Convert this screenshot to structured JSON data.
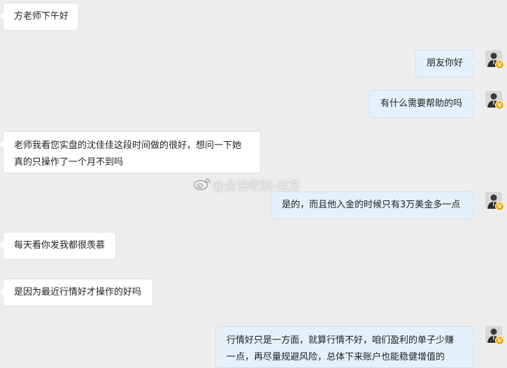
{
  "messages": [
    {
      "sender": "other",
      "text": "方老师下午好"
    },
    {
      "sender": "self",
      "text": "朋友你好"
    },
    {
      "sender": "self",
      "text": "有什么需要帮助的吗"
    },
    {
      "sender": "other",
      "line1": "老师我看您实盘的沈佳佳这段时间做的很好，想问一下她",
      "line2": "真的只操作了一个月不到吗"
    },
    {
      "sender": "self",
      "text": "是的，而且他入金的时候只有3万美金多一点"
    },
    {
      "sender": "other",
      "text": "每天看你发我都很羡慕"
    },
    {
      "sender": "other",
      "text": "是因为最近行情好才操作的好吗"
    },
    {
      "sender": "self",
      "line1": "行情好只是一方面，就算行情不好，咱们盈利的单子少赚",
      "line2": "一点，再尽量规避风险，总体下来账户也能稳健增值的"
    }
  ],
  "avatar": {
    "badge": "V",
    "badge_color": "#f2a900"
  },
  "watermark": {
    "text": "@金油收割-老方",
    "icon": "weibo-icon"
  },
  "colors": {
    "background": "#ededed",
    "incoming_bubble": "#ffffff",
    "outgoing_bubble": "#e4f0fb"
  }
}
